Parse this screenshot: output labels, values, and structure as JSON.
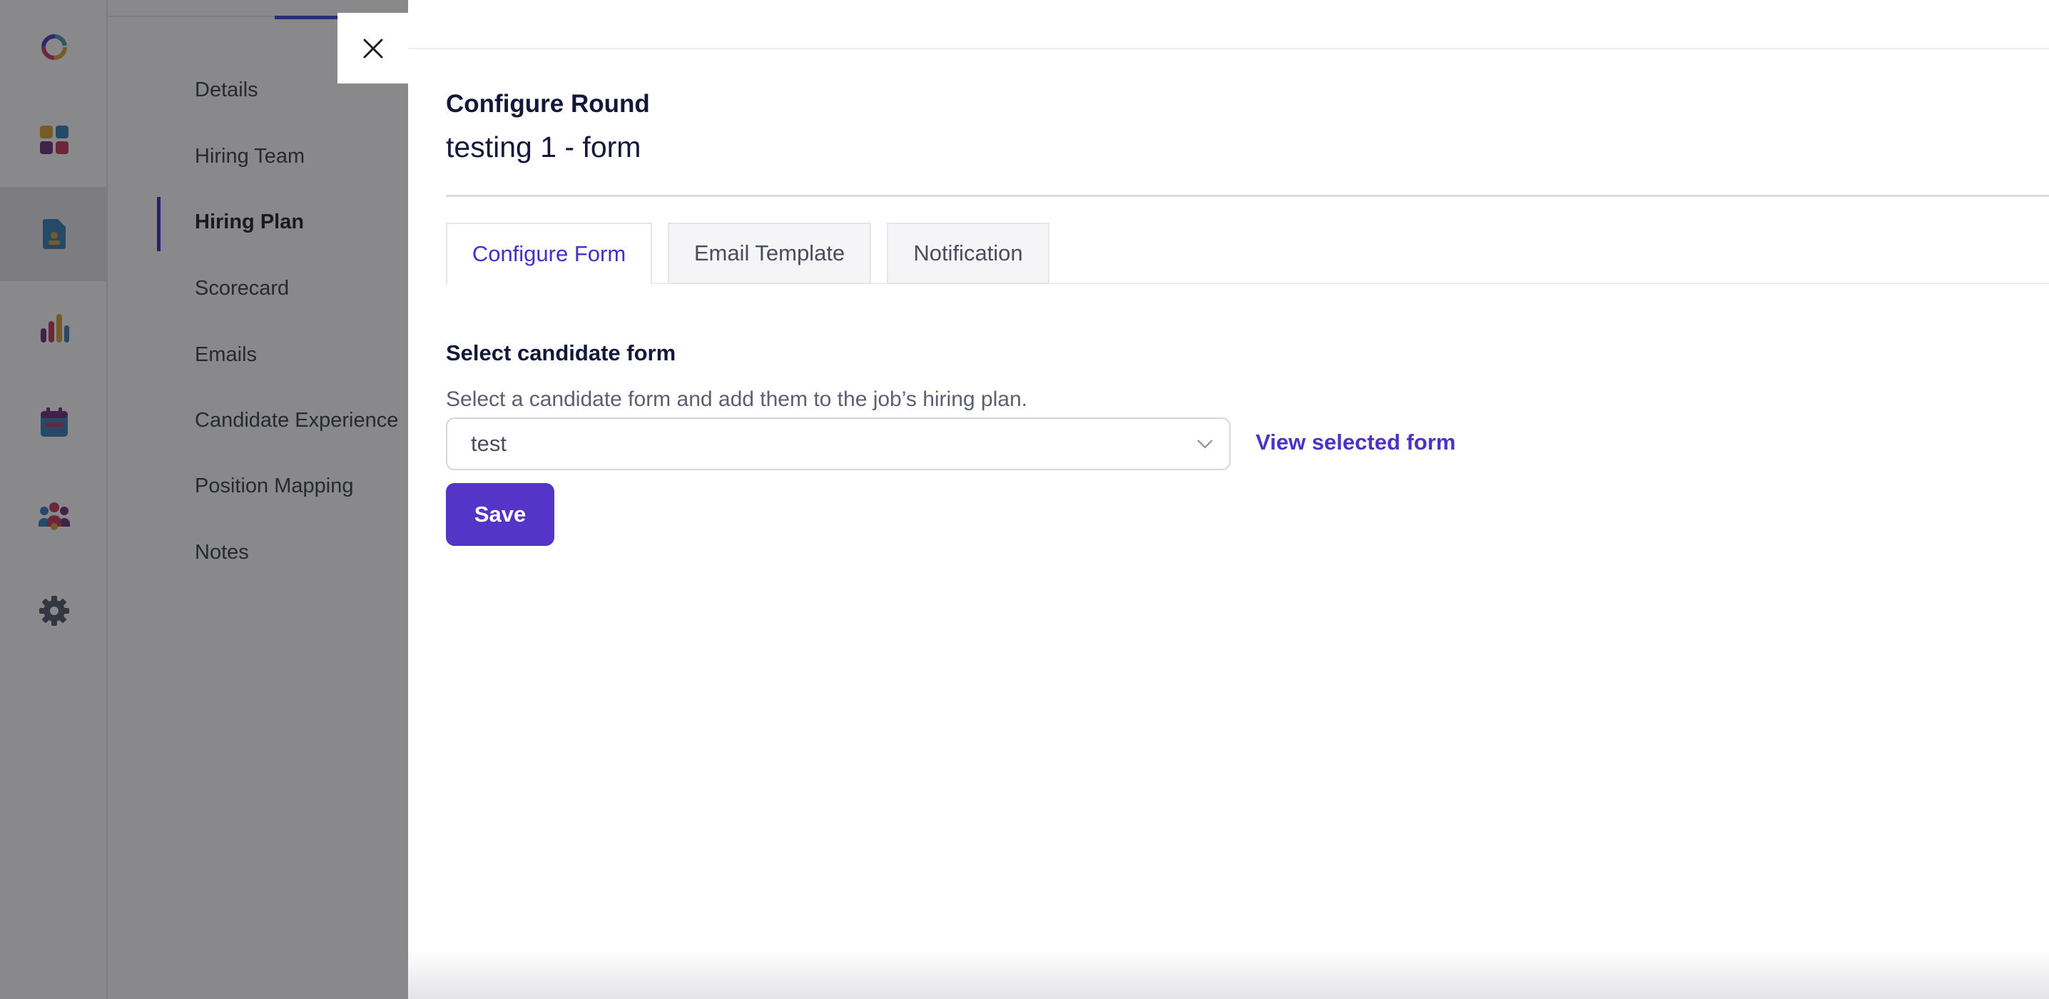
{
  "sidebar": {
    "icons": [
      "logo-icon",
      "dashboard-icon",
      "jobs-icon",
      "analytics-icon",
      "calendar-icon",
      "team-icon",
      "settings-icon"
    ]
  },
  "subnav": {
    "items": [
      {
        "label": "Details"
      },
      {
        "label": "Hiring Team"
      },
      {
        "label": "Hiring Plan"
      },
      {
        "label": "Scorecard"
      },
      {
        "label": "Emails"
      },
      {
        "label": "Candidate Experience"
      },
      {
        "label": "Position Mapping"
      },
      {
        "label": "Notes"
      }
    ],
    "active": "Hiring Plan"
  },
  "drawer": {
    "title": "Configure Round",
    "subtitle": "testing 1 - form",
    "tabs": [
      {
        "label": "Configure Form",
        "active": true
      },
      {
        "label": "Email Template",
        "active": false
      },
      {
        "label": "Notification",
        "active": false
      }
    ],
    "section": {
      "title": "Select candidate form",
      "description": "Select a candidate form and add them to the job’s hiring plan."
    },
    "select": {
      "value": "test"
    },
    "view_link": "View selected form",
    "save_label": "Save"
  },
  "colors": {
    "accent": "#5534c8",
    "link": "#4b31c9",
    "active_tab_text": "#4330cc",
    "heading": "#13183a"
  }
}
